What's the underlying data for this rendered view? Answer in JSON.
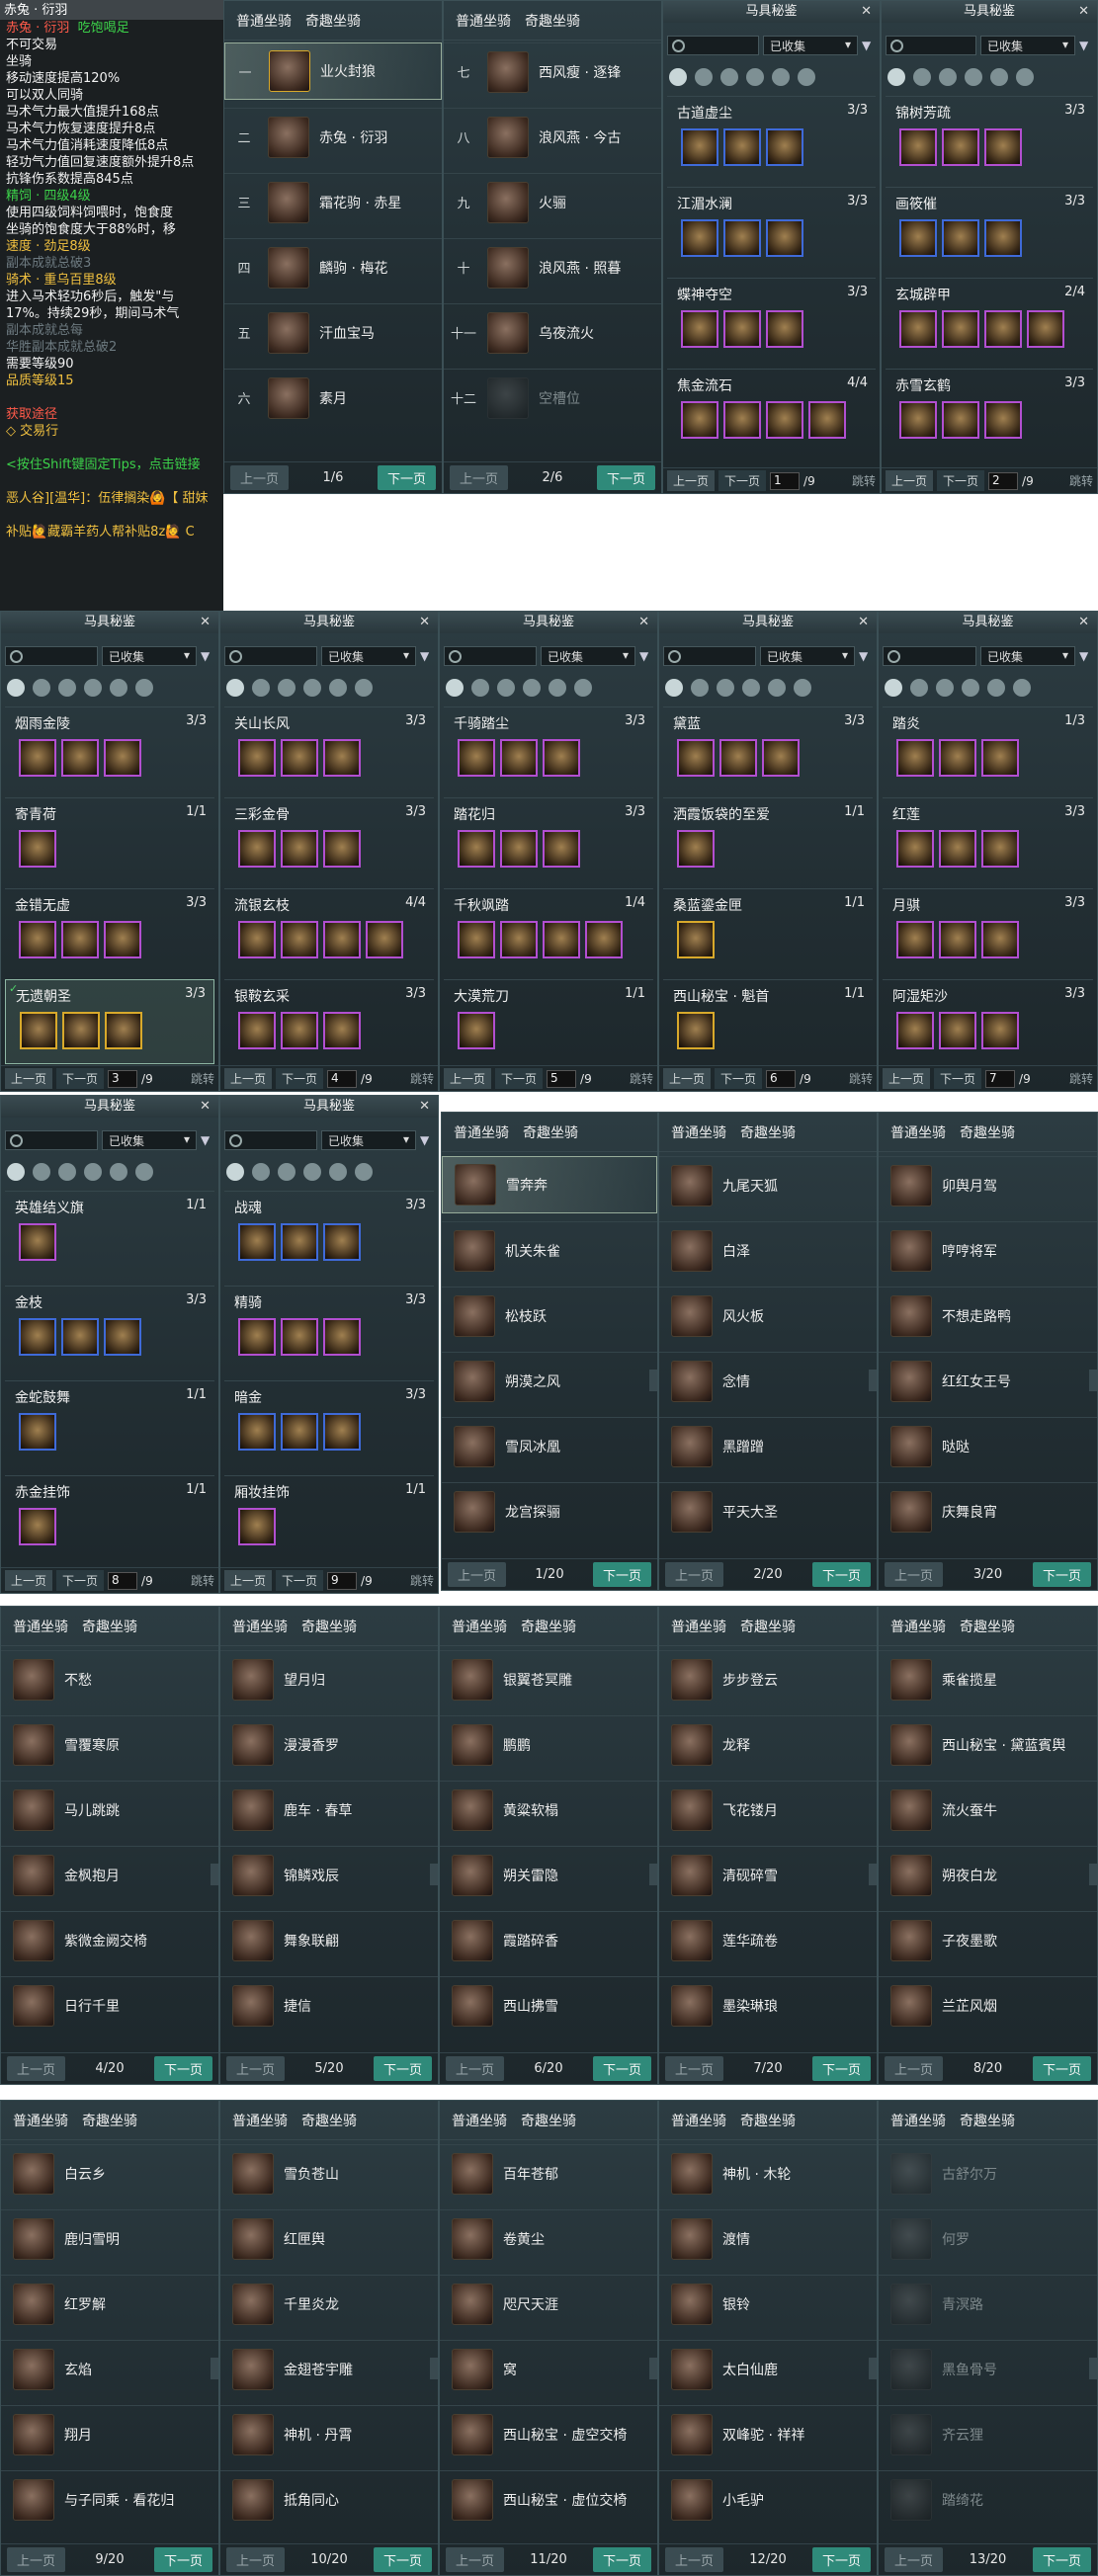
{
  "tooltip": {
    "header": "赤兔 · 衍羽",
    "title": "赤兔 · 衍羽",
    "status": "吃饱喝足",
    "lines": [
      "不可交易",
      "坐骑",
      "移动速度提高120%",
      "可以双人同骑",
      "马术气力最大值提升168点",
      "马术气力恢复速度提升8点",
      "马术气力值消耗速度降低8点",
      "轻功气力值回复速度额外提升8点",
      "抗锋伤系数提高845点"
    ],
    "food_name": "精饲 · 四级4级",
    "food_desc": [
      "使用四级饲料饲喂时，饱食度",
      "坐骑的饱食度大于88%时，移"
    ],
    "speed": "速度 · 劲足8级",
    "skill": "骑术 · 重乌百里8级",
    "skill_desc": [
      "进入马术轻功6秒后，触发\"与",
      "17%。持续29秒，期间马术气"
    ],
    "faded": [
      "副本成就总破3",
      "副本成就总每",
      "华胜副本成就总破2"
    ],
    "req_level": "需要等级90",
    "quality": "品质等级15",
    "source_label": "获取途径",
    "source": "◇ 交易行",
    "hint": "<按住Shift键固定Tips，点击链接",
    "chat1": "恶人谷][温华]：伍律搁染🙆【 甜妹",
    "chat2": "补贴🙋藏霸羊药人帮补贴8z🙋 C"
  },
  "mount_tabs": {
    "normal": "普通坐骑",
    "special": "奇趣坐骑",
    "prev": "上一页",
    "next": "下一页"
  },
  "mount_panels": [
    {
      "page": "1/6",
      "items": [
        {
          "n": "一",
          "name": "业火封狼"
        },
        {
          "n": "二",
          "name": "赤兔 · 衍羽"
        },
        {
          "n": "三",
          "name": "霜花驹 · 赤星"
        },
        {
          "n": "四",
          "name": "麟驹 · 梅花"
        },
        {
          "n": "五",
          "name": "汗血宝马"
        },
        {
          "n": "六",
          "name": "素月"
        }
      ]
    },
    {
      "page": "2/6",
      "items": [
        {
          "n": "七",
          "name": "西风瘦 · 逐锋"
        },
        {
          "n": "八",
          "name": "浪风燕 · 今古"
        },
        {
          "n": "九",
          "name": "火骊"
        },
        {
          "n": "十",
          "name": "浪风燕 · 照暮"
        },
        {
          "n": "十一",
          "name": "乌夜流火"
        },
        {
          "n": "十二",
          "name": "空槽位"
        }
      ]
    },
    {
      "page": "1/20",
      "items": [
        {
          "name": "雪奔奔"
        },
        {
          "name": "机关朱雀"
        },
        {
          "name": "松枝跃"
        },
        {
          "name": "朔漠之风"
        },
        {
          "name": "雪凤冰凰"
        },
        {
          "name": "龙宫探骊"
        }
      ]
    },
    {
      "page": "2/20",
      "items": [
        {
          "name": "九尾天狐"
        },
        {
          "name": "白泽"
        },
        {
          "name": "风火板"
        },
        {
          "name": "念情"
        },
        {
          "name": "黑蹭蹭"
        },
        {
          "name": "平天大圣"
        }
      ]
    },
    {
      "page": "3/20",
      "items": [
        {
          "name": "卯舆月驾"
        },
        {
          "name": "哼哼将军"
        },
        {
          "name": "不想走路鸭"
        },
        {
          "name": "红红女王号"
        },
        {
          "name": "哒哒"
        },
        {
          "name": "庆舞良宵"
        }
      ]
    },
    {
      "page": "4/20",
      "items": [
        {
          "name": "不愁"
        },
        {
          "name": "雪覆寒原"
        },
        {
          "name": "马儿跳跳"
        },
        {
          "name": "金枫抱月"
        },
        {
          "name": "紫微金阙交椅"
        },
        {
          "name": "日行千里"
        }
      ]
    },
    {
      "page": "5/20",
      "items": [
        {
          "name": "望月归"
        },
        {
          "name": "漫漫香罗"
        },
        {
          "name": "鹿车 · 春草"
        },
        {
          "name": "锦鳞戏辰"
        },
        {
          "name": "舞象联翩"
        },
        {
          "name": "捷信"
        }
      ]
    },
    {
      "page": "6/20",
      "items": [
        {
          "name": "银翼苍冥雕"
        },
        {
          "name": "鹏鹏"
        },
        {
          "name": "黄粱软榻"
        },
        {
          "name": "朔关雷隐"
        },
        {
          "name": "霞踏碎香"
        },
        {
          "name": "西山拂雪"
        }
      ]
    },
    {
      "page": "7/20",
      "items": [
        {
          "name": "步步登云"
        },
        {
          "name": "龙释"
        },
        {
          "name": "飞花镂月"
        },
        {
          "name": "清砚碎雪"
        },
        {
          "name": "莲华疏卷"
        },
        {
          "name": "墨染琳琅"
        }
      ]
    },
    {
      "page": "8/20",
      "items": [
        {
          "name": "乘雀揽星"
        },
        {
          "name": "西山秘宝 · 黛蓝賓舆"
        },
        {
          "name": "流火蚕牛"
        },
        {
          "name": "朔夜白龙"
        },
        {
          "name": "子夜墨歌"
        },
        {
          "name": "兰芷风烟"
        }
      ]
    },
    {
      "page": "9/20",
      "items": [
        {
          "name": "白云乡"
        },
        {
          "name": "鹿归雪明"
        },
        {
          "name": "红罗解"
        },
        {
          "name": "玄焰"
        },
        {
          "name": "翔月"
        },
        {
          "name": "与子同乘 · 看花归"
        }
      ]
    },
    {
      "page": "10/20",
      "items": [
        {
          "name": "雪负苍山"
        },
        {
          "name": "红匣舆"
        },
        {
          "name": "千里炎龙"
        },
        {
          "name": "金翅苍宇雕"
        },
        {
          "name": "神机 · 丹霄"
        },
        {
          "name": "抵角同心"
        }
      ]
    },
    {
      "page": "11/20",
      "items": [
        {
          "name": "百年苍郁"
        },
        {
          "name": "卷黄尘"
        },
        {
          "name": "咫尺天涯"
        },
        {
          "name": "窝"
        },
        {
          "name": "西山秘宝 · 虚空交椅"
        },
        {
          "name": "西山秘宝 · 虚位交椅"
        }
      ]
    },
    {
      "page": "12/20",
      "items": [
        {
          "name": "神机 · 木轮"
        },
        {
          "name": "渡情"
        },
        {
          "name": "银铃"
        },
        {
          "name": "太白仙鹿"
        },
        {
          "name": "双峰驼 · 祥祥"
        },
        {
          "name": "小毛驴"
        }
      ]
    },
    {
      "page": "13/20",
      "items": [
        {
          "name": "古舒尔万"
        },
        {
          "name": "何罗"
        },
        {
          "name": "青溟路"
        },
        {
          "name": "黑鱼骨号"
        },
        {
          "name": "齐云狸"
        },
        {
          "name": "踏绮花"
        }
      ]
    }
  ],
  "gear_common": {
    "title": "马具秘鉴",
    "filter": "已收集",
    "prev": "上一页",
    "next": "下一页",
    "jump": "跳转",
    "total": "/9"
  },
  "gear_panels": [
    {
      "page": "1",
      "sets": [
        {
          "name": "古道虚尘",
          "count": "3/3"
        },
        {
          "name": "江湄水澜",
          "count": "3/3"
        },
        {
          "name": "蝶神夺空",
          "count": "3/3"
        },
        {
          "name": "焦金流石",
          "count": "4/4"
        }
      ]
    },
    {
      "page": "2",
      "sets": [
        {
          "name": "锦树芳疏",
          "count": "3/3"
        },
        {
          "name": "画筱催",
          "count": "3/3"
        },
        {
          "name": "玄城辟甲",
          "count": "2/4"
        },
        {
          "name": "赤雪玄鹤",
          "count": "3/3"
        }
      ]
    },
    {
      "page": "3",
      "sets": [
        {
          "name": "烟雨金陵",
          "count": "3/3"
        },
        {
          "name": "寄青荷",
          "count": "1/1"
        },
        {
          "name": "金错无虚",
          "count": "3/3"
        },
        {
          "name": "无遗朝圣",
          "count": "3/3"
        }
      ]
    },
    {
      "page": "4",
      "sets": [
        {
          "name": "关山长风",
          "count": "3/3"
        },
        {
          "name": "三彩金骨",
          "count": "3/3"
        },
        {
          "name": "流银玄枝",
          "count": "4/4"
        },
        {
          "name": "银鞍玄采",
          "count": "3/3"
        }
      ]
    },
    {
      "page": "5",
      "sets": [
        {
          "name": "千骑踏尘",
          "count": "3/3"
        },
        {
          "name": "踏花归",
          "count": "3/3"
        },
        {
          "name": "千秋飒踏",
          "count": "1/4"
        },
        {
          "name": "大漠荒刀",
          "count": "1/1"
        }
      ]
    },
    {
      "page": "6",
      "sets": [
        {
          "name": "黛蓝",
          "count": "3/3"
        },
        {
          "name": "洒霞饭袋的至爱",
          "count": "1/1"
        },
        {
          "name": "桑蓝鎏金匣",
          "count": "1/1"
        },
        {
          "name": "西山秘宝 · 魁首",
          "count": "1/1"
        }
      ]
    },
    {
      "page": "7",
      "sets": [
        {
          "name": "踏炎",
          "count": "1/3"
        },
        {
          "name": "红莲",
          "count": "3/3"
        },
        {
          "name": "月骐",
          "count": "3/3"
        },
        {
          "name": "阿湿矩沙",
          "count": "3/3"
        }
      ]
    },
    {
      "page": "8",
      "sets": [
        {
          "name": "英雄结义旗",
          "count": "1/1"
        },
        {
          "name": "金枝",
          "count": "3/3"
        },
        {
          "name": "金蛇鼓舞",
          "count": "1/1"
        },
        {
          "name": "赤金挂饰",
          "count": "1/1"
        }
      ]
    },
    {
      "page": "9",
      "sets": [
        {
          "name": "战魂",
          "count": "3/3"
        },
        {
          "name": "精骑",
          "count": "3/3"
        },
        {
          "name": "暗金",
          "count": "3/3"
        },
        {
          "name": "厢妆挂饰",
          "count": "1/1"
        }
      ]
    }
  ]
}
